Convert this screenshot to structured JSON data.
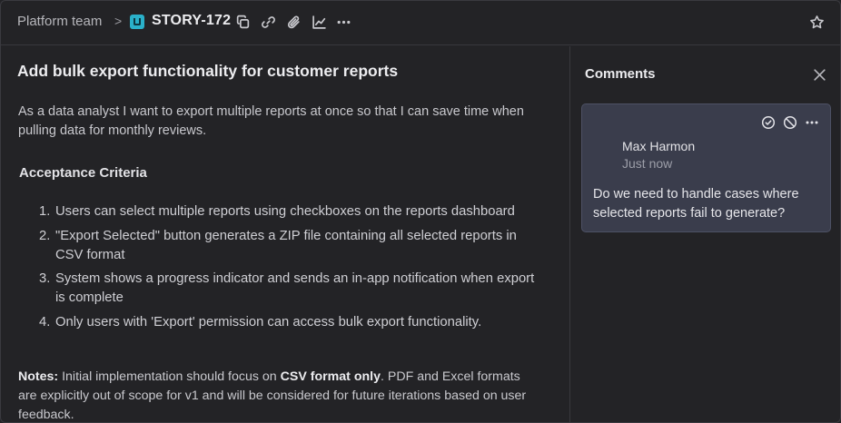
{
  "header": {
    "team": "Platform team",
    "separator": ">",
    "story_id": "STORY-172",
    "icons": [
      "copy-icon",
      "link-icon",
      "attachment-icon",
      "chart-icon",
      "more-icon",
      "star-icon"
    ],
    "badge_color": "#2ab0c9"
  },
  "story": {
    "title": "Add bulk export functionality for customer reports",
    "description": "As a data analyst I want to export multiple reports at once so that I can save time when pulling data for monthly reviews.",
    "acceptance_heading": "Acceptance Criteria",
    "criteria": [
      {
        "num": "1.",
        "text": "Users can select multiple reports using checkboxes on the reports dashboard"
      },
      {
        "num": "2.",
        "text": "\"Export Selected\" button generates a ZIP file containing all selected reports in CSV format"
      },
      {
        "num": "3.",
        "text": "System shows a progress indicator and sends an in-app notification when export is complete"
      },
      {
        "num": "4.",
        "text": "Only users with 'Export' permission can access bulk export functionality."
      }
    ],
    "notes_label": "Notes:",
    "notes_part1": " Initial implementation should focus on ",
    "notes_emphasis": "CSV format only",
    "notes_part2": ". PDF and Excel formats are explicitly out of scope for v1 and will be considered for future iterations based on user feedback."
  },
  "comments": {
    "title": "Comments",
    "items": [
      {
        "author": "Max Harmon",
        "time": "Just now",
        "body": "Do we need to handle cases where selected reports fail to generate?",
        "icons": [
          "resolve-icon",
          "block-icon",
          "more-icon"
        ]
      }
    ]
  },
  "colors": {
    "background": "#232326",
    "comment_card": "#3a3d4c",
    "accent": "#2ab0c9"
  }
}
